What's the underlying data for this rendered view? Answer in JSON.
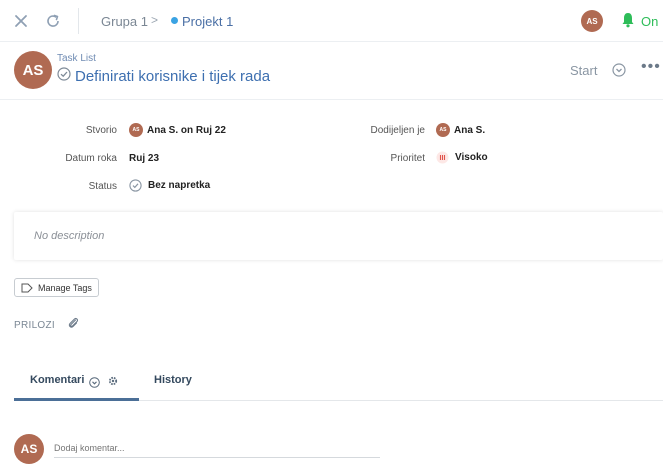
{
  "topbar": {
    "close_icon": "close-icon",
    "refresh_icon": "refresh-icon",
    "breadcrumb": [
      "Grupa 1",
      "Projekt 1"
    ],
    "breadcrumb_separator": ">",
    "user_initials": "AS",
    "notification_label": "On"
  },
  "header": {
    "avatar_initials": "AS",
    "list_label": "Task List",
    "title": "Definirati korisnike i tijek rada",
    "start_label": "Start"
  },
  "fields": {
    "created_by_label": "Stvorio",
    "created_by_initials": "AS",
    "created_by_value": "Ana S. on Ruj 22",
    "assigned_label": "Dodijeljen je",
    "assigned_initials": "AS",
    "assigned_value": "Ana S.",
    "due_label": "Datum roka",
    "due_value": "Ruj 23",
    "priority_label": "Prioritet",
    "priority_value": "Visoko",
    "status_label": "Status",
    "status_value": "Bez napretka"
  },
  "description": {
    "placeholder": "No description"
  },
  "tags": {
    "button_label": "Manage Tags"
  },
  "attachments": {
    "label": "PRILOZI"
  },
  "tabs": [
    {
      "label": "Komentari",
      "active": true
    },
    {
      "label": "History",
      "active": false
    }
  ],
  "comment": {
    "avatar_initials": "AS",
    "placeholder": "Dodaj komentar..."
  },
  "colors": {
    "avatar": "#b06a52",
    "accent": "#3d6fb0",
    "notify": "#2ebd59",
    "priority": "#e0534a"
  }
}
